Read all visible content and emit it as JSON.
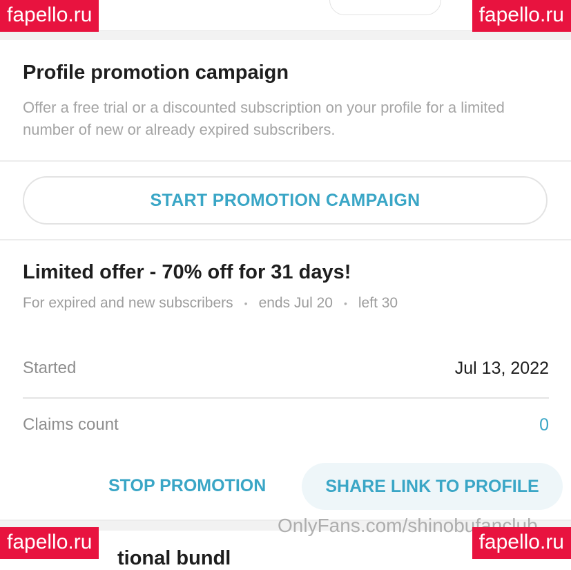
{
  "promotion_section": {
    "title": "Profile promotion campaign",
    "description": "Offer a free trial or a discounted subscription on your profile for a limited number of new or already expired subscribers.",
    "start_button_label": "START PROMOTION CAMPAIGN"
  },
  "offer": {
    "title": "Limited offer - 70% off for 31 days!",
    "meta": [
      "For expired and new subscribers",
      "ends Jul 20",
      "left 30"
    ],
    "meta_separator": "•",
    "details": [
      {
        "label": "Started",
        "value": "Jul 13, 2022"
      },
      {
        "label": "Claims count",
        "value": "0"
      }
    ],
    "stop_button_label": "STOP PROMOTION",
    "share_button_label": "SHARE LINK TO PROFILE"
  },
  "next_section_title_partial": "tional bundl",
  "overlays": {
    "badge_text": "fapello.ru",
    "watermark_text": "OnlyFans.com/shinobufanclub"
  },
  "colors": {
    "accent": "#3aa6c6",
    "badge": "#e8133f",
    "muted_text": "#a4a4a4"
  }
}
